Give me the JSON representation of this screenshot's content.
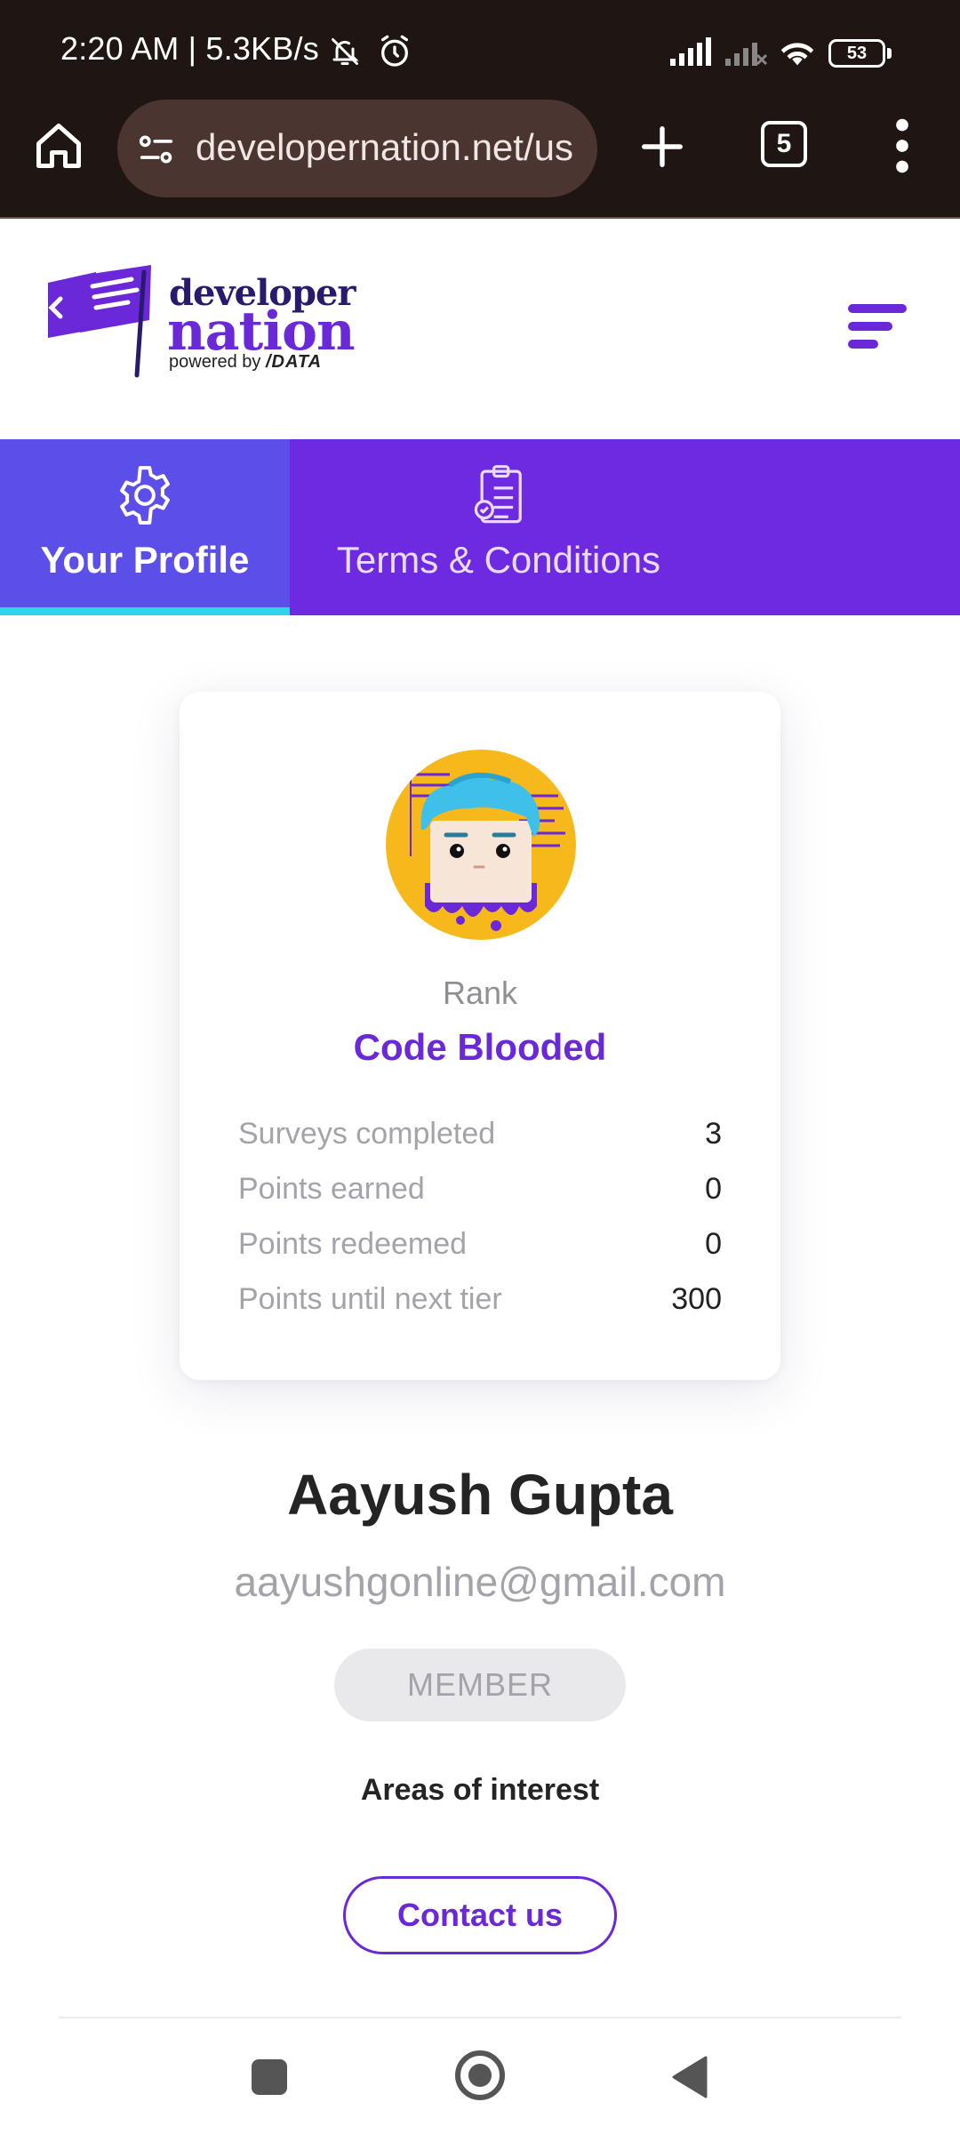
{
  "status_bar": {
    "time": "2:20 AM | 5.3KB/s",
    "battery": "53",
    "icons": [
      "bell-off-icon",
      "alarm-icon",
      "signal-icon",
      "signal-off-icon",
      "wifi-icon",
      "battery-icon"
    ]
  },
  "browser": {
    "url": "developernation.net/us",
    "tab_count": "5",
    "icons": [
      "home-icon",
      "site-settings-icon",
      "plus-icon",
      "tabs-icon",
      "more-vertical-icon"
    ]
  },
  "site": {
    "logo_line1": "developer",
    "logo_line2": "nation",
    "logo_powered": "powered by",
    "logo_brand": "/DATA",
    "menu_icon": "hamburger-menu-icon",
    "brand_color": "#6a28d9"
  },
  "tabs": [
    {
      "label": "Your Profile",
      "icon": "gear-icon",
      "active": true
    },
    {
      "label": "Terms & Conditions",
      "icon": "clipboard-icon",
      "active": false
    }
  ],
  "profile_card": {
    "rank_label": "Rank",
    "rank_name": "Code Blooded",
    "stats": [
      {
        "label": "Surveys completed",
        "value": "3"
      },
      {
        "label": "Points earned",
        "value": "0"
      },
      {
        "label": "Points redeemed",
        "value": "0"
      },
      {
        "label": "Points until next tier",
        "value": "300"
      }
    ]
  },
  "user": {
    "name": "Aayush Gupta",
    "email": "aayushgonline@gmail.com",
    "badge": "MEMBER",
    "areas_heading": "Areas of interest",
    "contact_label": "Contact us"
  },
  "nav": {
    "icons": [
      "recent-apps-icon",
      "home-circle-icon",
      "back-triangle-icon"
    ]
  }
}
